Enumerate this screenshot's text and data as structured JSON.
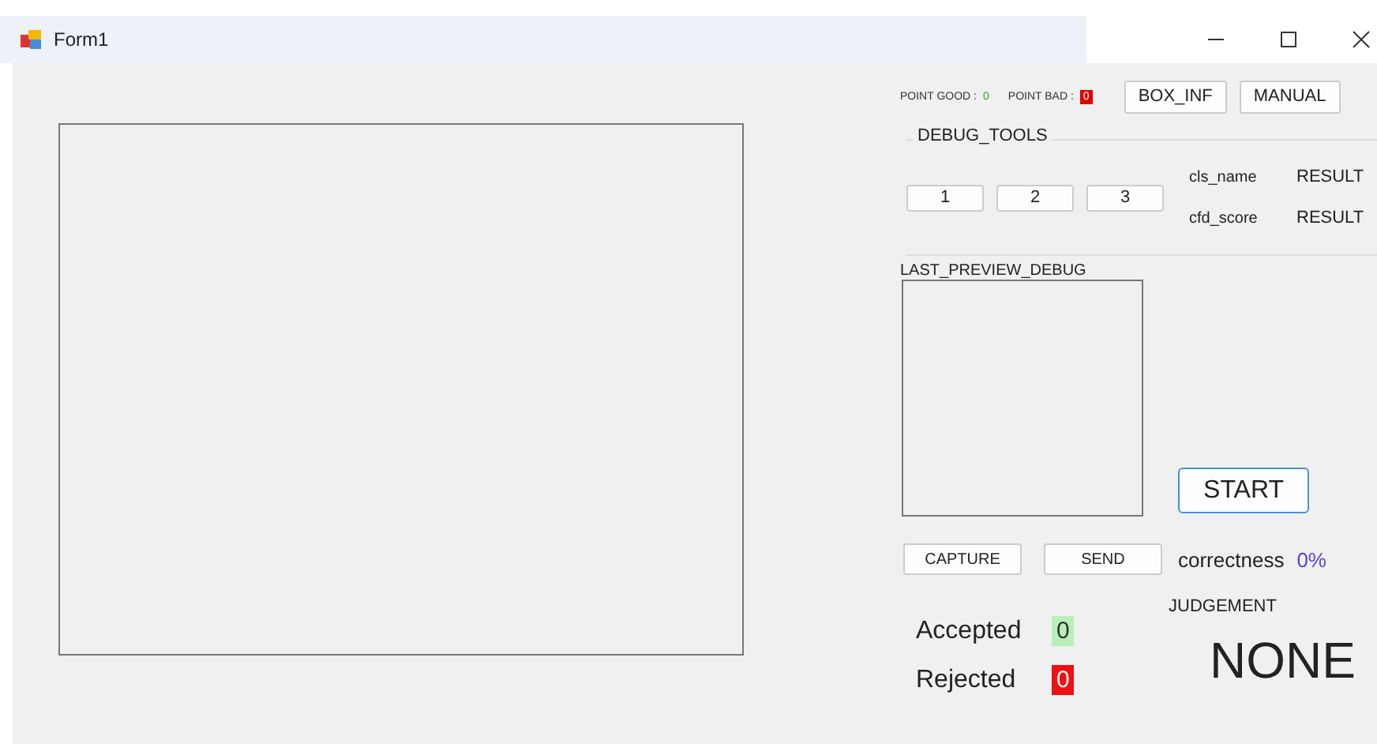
{
  "window": {
    "title": "Form1"
  },
  "points": [
    {
      "label": "POINT GOOD :",
      "value": "0",
      "color": "#22aa22",
      "kind": "text"
    },
    {
      "label": "POINT BAD :",
      "value": "0",
      "color": "#e00000",
      "kind": "box"
    }
  ],
  "top_buttons": [
    "BOX_INF",
    "MANUAL"
  ],
  "debug_tools": {
    "title": "DEBUG_TOOLS",
    "buttons": [
      "1",
      "2",
      "3"
    ],
    "fields": [
      {
        "label": "cls_name",
        "value": "RESULT"
      },
      {
        "label": "cfd_score",
        "value": "RESULT"
      }
    ]
  },
  "preview": {
    "label": "LAST_PREVIEW_DEBUG"
  },
  "start_button": "START",
  "action_buttons": [
    "CAPTURE",
    "SEND"
  ],
  "correctness": {
    "label": "correctness",
    "value": "0%"
  },
  "judgement": {
    "label": "JUDGEMENT",
    "value": "NONE"
  },
  "counters": [
    {
      "label": "Accepted",
      "value": "0",
      "color": "#b8f0b8"
    },
    {
      "label": "Rejected",
      "value": "0",
      "color": "#ee1111"
    }
  ]
}
